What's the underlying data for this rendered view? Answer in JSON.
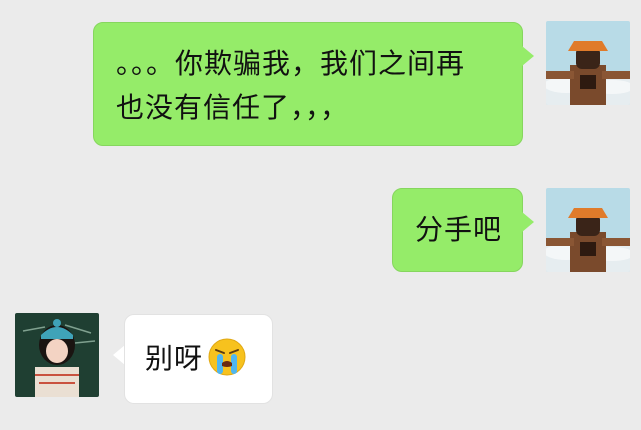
{
  "messages": [
    {
      "sender": "self",
      "text_line1": "。。。你欺骗我，我们之间再",
      "text_line2": "也没有信任了，，，"
    },
    {
      "sender": "self",
      "text": "分手吧"
    },
    {
      "sender": "other",
      "text": "别呀",
      "emoji": "crying-face-emoji"
    }
  ],
  "colors": {
    "background": "#ebebeb",
    "outgoing_bubble": "#95ec69",
    "incoming_bubble": "#ffffff"
  },
  "icons": {
    "self_avatar": "anime-character-avatar",
    "other_avatar": "girl-classroom-avatar"
  }
}
